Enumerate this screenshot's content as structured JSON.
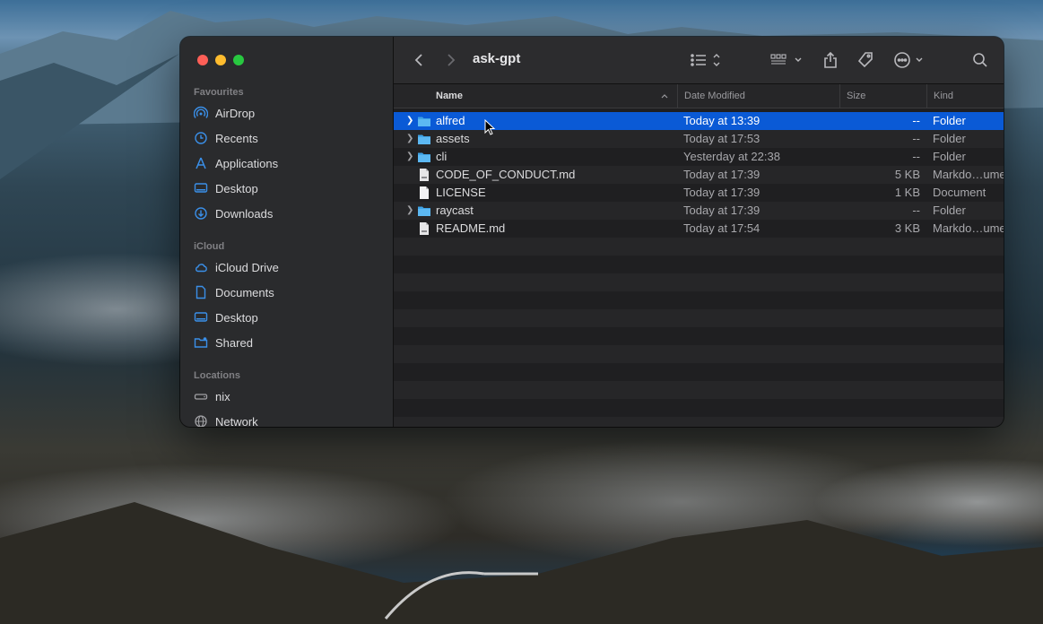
{
  "window": {
    "title": "ask-gpt"
  },
  "sidebar": {
    "sections": [
      {
        "label": "Favourites",
        "items": [
          {
            "label": "AirDrop",
            "icon": "airdrop-icon"
          },
          {
            "label": "Recents",
            "icon": "clock-icon"
          },
          {
            "label": "Applications",
            "icon": "applications-icon"
          },
          {
            "label": "Desktop",
            "icon": "desktop-icon"
          },
          {
            "label": "Downloads",
            "icon": "download-icon"
          }
        ]
      },
      {
        "label": "iCloud",
        "items": [
          {
            "label": "iCloud Drive",
            "icon": "cloud-icon"
          },
          {
            "label": "Documents",
            "icon": "document-icon"
          },
          {
            "label": "Desktop",
            "icon": "desktop-icon"
          },
          {
            "label": "Shared",
            "icon": "shared-folder-icon"
          }
        ]
      },
      {
        "label": "Locations",
        "items": [
          {
            "label": "nix",
            "icon": "disk-icon"
          },
          {
            "label": "Network",
            "icon": "globe-icon"
          }
        ]
      }
    ]
  },
  "toolbar": {
    "back": "chevron-left-icon",
    "forward": "chevron-right-icon",
    "view": "list-view-icon",
    "group": "grid-group-icon",
    "share": "share-icon",
    "tag": "tag-icon",
    "more": "ellipsis-circle-icon",
    "search": "search-icon"
  },
  "columns": {
    "name": "Name",
    "date": "Date Modified",
    "size": "Size",
    "kind": "Kind"
  },
  "files": [
    {
      "name": "alfred",
      "date": "Today at 13:39",
      "size": "--",
      "kind": "Folder",
      "type": "folder",
      "selected": true
    },
    {
      "name": "assets",
      "date": "Today at 17:53",
      "size": "--",
      "kind": "Folder",
      "type": "folder",
      "selected": false
    },
    {
      "name": "cli",
      "date": "Yesterday at 22:38",
      "size": "--",
      "kind": "Folder",
      "type": "folder",
      "selected": false
    },
    {
      "name": "CODE_OF_CONDUCT.md",
      "date": "Today at 17:39",
      "size": "5 KB",
      "kind": "Markdo…ument",
      "type": "markdown",
      "selected": false
    },
    {
      "name": "LICENSE",
      "date": "Today at 17:39",
      "size": "1 KB",
      "kind": "Document",
      "type": "document",
      "selected": false
    },
    {
      "name": "raycast",
      "date": "Today at 17:39",
      "size": "--",
      "kind": "Folder",
      "type": "folder",
      "selected": false
    },
    {
      "name": "README.md",
      "date": "Today at 17:54",
      "size": "3 KB",
      "kind": "Markdo…ument",
      "type": "markdown",
      "selected": false
    }
  ],
  "colors": {
    "selection": "#0a5ad6",
    "folder": "#3fa3e6",
    "sidebar_icon": "#3a8fe8"
  }
}
